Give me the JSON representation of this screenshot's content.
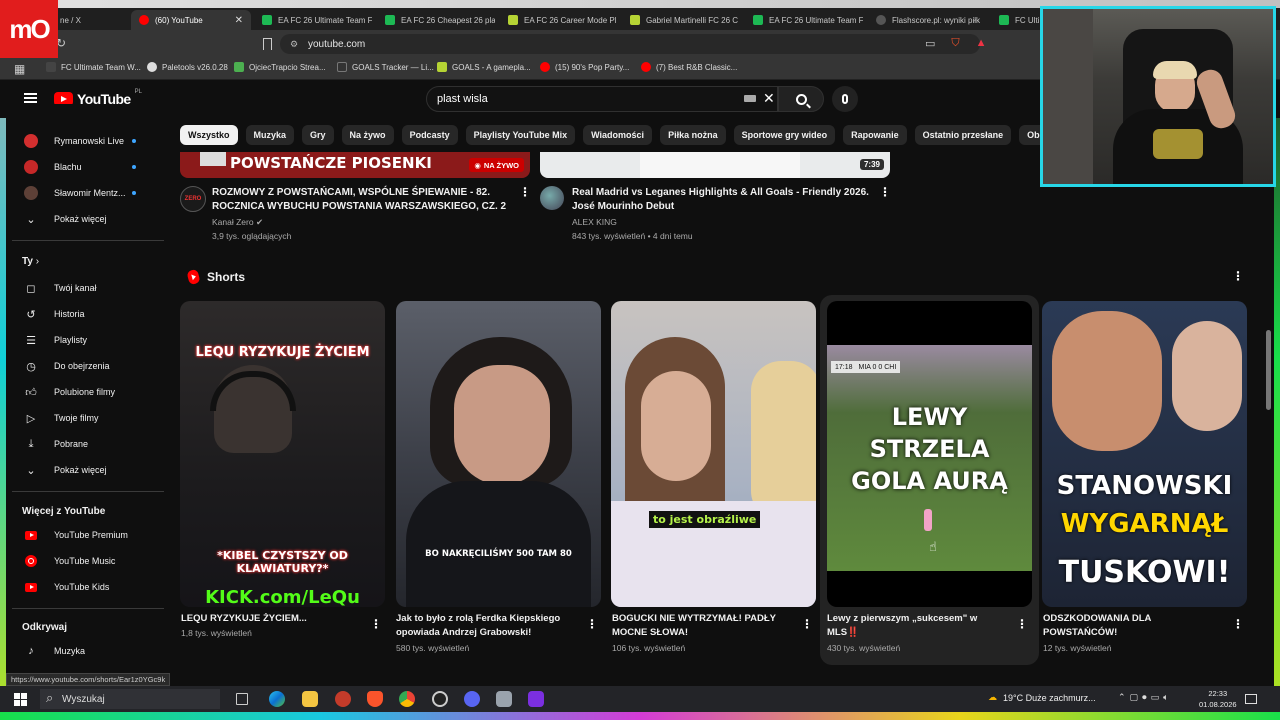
{
  "browser": {
    "tabs": [
      {
        "label": "ne / X",
        "fav": "#000000"
      },
      {
        "label": "(60) YouTube",
        "fav": "#ff0000",
        "active": true
      },
      {
        "label": "EA FC 26 Ultimate Team F",
        "fav": "#1db954"
      },
      {
        "label": "EA FC 26 Cheapest 26 pla",
        "fav": "#1db954"
      },
      {
        "label": "EA FC 26 Career Mode Pl",
        "fav": "#b5d334"
      },
      {
        "label": "Gabriel Martinelli FC 26 C",
        "fav": "#b5d334"
      },
      {
        "label": "EA FC 26 Ultimate Team F",
        "fav": "#1db954"
      },
      {
        "label": "Flashscore.pl: wyniki piłk",
        "fav": "#222222"
      },
      {
        "label": "FC Ultim",
        "fav": "#1db954"
      }
    ],
    "address": "youtube.com",
    "bookmarks": [
      {
        "label": "FC Ultimate Team W...",
        "fav": "#444444"
      },
      {
        "label": "Paletools v26.0.28",
        "fav": "#dddddd"
      },
      {
        "label": "OjciecTrapcio Strea...",
        "fav": "#4caf50"
      },
      {
        "label": "GOALS Tracker — Li...",
        "fav": "#333333"
      },
      {
        "label": "GOALS - A gamepla...",
        "fav": "#b5d334"
      },
      {
        "label": "(15) 90's Pop Party...",
        "fav": "#ff0000"
      },
      {
        "label": "(7) Best R&B Classic...",
        "fav": "#ff0000"
      }
    ],
    "status_url": "https://www.youtube.com/shorts/Ear1z0YGc9k",
    "logo_text": "mO"
  },
  "youtube": {
    "logo": "YouTube",
    "country": "PL",
    "search_value": "plast wisla",
    "chips": [
      "Wszystko",
      "Muzyka",
      "Gry",
      "Na żywo",
      "Podcasty",
      "Playlisty YouTube Mix",
      "Wiadomości",
      "Piłka nożna",
      "Sportowe gry wideo",
      "Rapowanie",
      "Ostatnio przesłane",
      "Obejrzan"
    ]
  },
  "sidebar": {
    "subs": [
      {
        "label": "Rymanowski Live",
        "color": "#d32f2f"
      },
      {
        "label": "Blachu",
        "color": "#c62828"
      },
      {
        "label": "Sławomir Mentz...",
        "color": "#5d4037"
      }
    ],
    "show_more": "Pokaż więcej",
    "you_heading": "Ty",
    "you_items": [
      {
        "label": "Twój kanał",
        "icon": "user-icon"
      },
      {
        "label": "Historia",
        "icon": "history-icon"
      },
      {
        "label": "Playlisty",
        "icon": "playlist-icon"
      },
      {
        "label": "Do obejrzenia",
        "icon": "clock-icon"
      },
      {
        "label": "Polubione filmy",
        "icon": "thumb-up-icon"
      },
      {
        "label": "Twoje filmy",
        "icon": "video-icon"
      },
      {
        "label": "Pobrane",
        "icon": "download-icon"
      }
    ],
    "show_more_2": "Pokaż więcej",
    "more_heading": "Więcej z YouTube",
    "more_items": [
      "YouTube Premium",
      "YouTube Music",
      "YouTube Kids"
    ],
    "explore_heading": "Odkrywaj",
    "explore_items": [
      "Muzyka"
    ]
  },
  "videos": [
    {
      "title": "ROZMOWY Z POWSTAŃCAMI, WSPÓLNE ŚPIEWANIE - 82. ROCZNICA WYBUCHU POWSTANIA WARSZAWSKIEGO, CZ. 2",
      "channel": "Kanał Zero",
      "meta": "3,9 tys. oglądających",
      "thumb_text": "POWSTAŃCZE PIOSENKI",
      "badge": "NA ŻYWO"
    },
    {
      "title": "Real Madrid vs Leganes Highlights & All Goals - Friendly 2026. José Mourinho Debut",
      "channel": "ALEX KING",
      "meta": "843 tys. wyświetleń • 4 dni temu",
      "duration": "7:39"
    }
  ],
  "shorts": {
    "heading": "Shorts",
    "items": [
      {
        "title": "LEQU RYZYKUJE ŻYCIEM...",
        "views": "1,8 tys. wyświetleń",
        "ov_top": "LEQU RYZYKUJE ŻYCIEM",
        "ov_mid": "*KIBEL CZYSTSZY OD KLAWIATURY?*",
        "ov_bottom": "KICK.com/LeQu"
      },
      {
        "title": "Jak to było z rolą Ferdka Kiepskiego opowiada Andrzej Grabowski!",
        "views": "580 tys. wyświetleń",
        "ov_mid": "BO NAKRĘCILIŚMY 500 TAM 80"
      },
      {
        "title": "BOGUCKI NIE WYTRZYMAŁ! PADŁY MOCNE SŁOWA!",
        "views": "106 tys. wyświetleń",
        "ov_mid": "to jest obraźliwe"
      },
      {
        "title": "Lewy z pierwszym „sukcesem\" w MLS‼️",
        "views": "430 tys. wyświetleń",
        "ov_mid": "LEWY STRZELA GOLA AURĄ",
        "score": "MIA 0 0 CHI",
        "clock": "17:18"
      },
      {
        "title": "ODSZKODOWANIA DLA POWSTAŃCÓW!",
        "views": "12 tys. wyświetleń",
        "ov_top": "STANOWSKI",
        "ov_mid": "WYGARNĄŁ",
        "ov_bottom": "TUSKOWI!"
      }
    ]
  },
  "taskbar": {
    "search_placeholder": "Wyszukaj",
    "weather": "19°C  Duże zachmurz...",
    "time": "22:33",
    "date": "01.08.2026"
  }
}
